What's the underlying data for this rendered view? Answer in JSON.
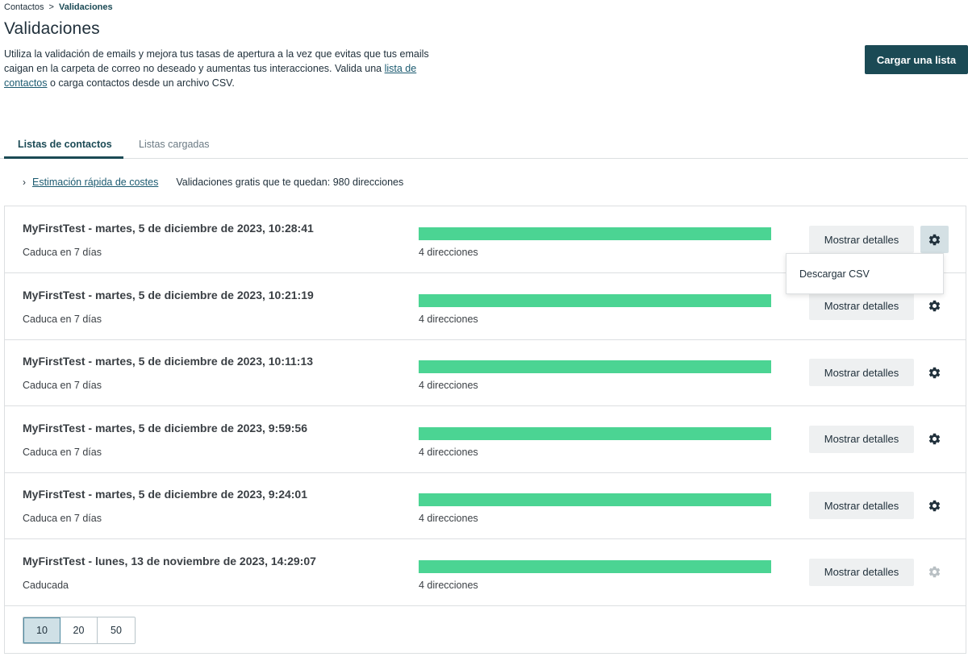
{
  "breadcrumb": {
    "parent": "Contactos",
    "separator": ">",
    "current": "Validaciones"
  },
  "page": {
    "title": "Validaciones",
    "intro_part1": "Utiliza la validación de emails y mejora tus tasas de apertura a la vez que evitas que tus emails caigan en la carpeta de correo no deseado y aumentas tus interacciones. Valida una ",
    "intro_link": "lista de contactos",
    "intro_part2": " o carga contactos desde un archivo CSV.",
    "upload_button": "Cargar una lista"
  },
  "tabs": [
    {
      "label": "Listas de contactos",
      "active": true
    },
    {
      "label": "Listas cargadas",
      "active": false
    }
  ],
  "estimate": {
    "link": "Estimación rápida de costes",
    "free_validations": "Validaciones gratis que te quedan: 980 direcciones"
  },
  "rows": [
    {
      "title": "MyFirstTest - martes, 5 de diciembre de 2023, 10:28:41",
      "status": "Caduca en 7 días",
      "addresses": "4 direcciones",
      "progress": 1.0,
      "details_label": "Mostrar detalles",
      "gear_state": "open"
    },
    {
      "title": "MyFirstTest - martes, 5 de diciembre de 2023, 10:21:19",
      "status": "Caduca en 7 días",
      "addresses": "4 direcciones",
      "progress": 1.0,
      "details_label": "Mostrar detalles",
      "gear_state": "active"
    },
    {
      "title": "MyFirstTest - martes, 5 de diciembre de 2023, 10:11:13",
      "status": "Caduca en 7 días",
      "addresses": "4 direcciones",
      "progress": 1.0,
      "details_label": "Mostrar detalles",
      "gear_state": "active"
    },
    {
      "title": "MyFirstTest - martes, 5 de diciembre de 2023, 9:59:56",
      "status": "Caduca en 7 días",
      "addresses": "4 direcciones",
      "progress": 1.0,
      "details_label": "Mostrar detalles",
      "gear_state": "active"
    },
    {
      "title": "MyFirstTest - martes, 5 de diciembre de 2023, 9:24:01",
      "status": "Caduca en 7 días",
      "addresses": "4 direcciones",
      "progress": 1.0,
      "details_label": "Mostrar detalles",
      "gear_state": "active"
    },
    {
      "title": "MyFirstTest - lunes, 13 de noviembre de 2023, 14:29:07",
      "status": "Caducada",
      "addresses": "4 direcciones",
      "progress": 1.0,
      "details_label": "Mostrar detalles",
      "gear_state": "disabled"
    }
  ],
  "dropdown": {
    "item": "Descargar CSV"
  },
  "pagination": {
    "options": [
      "10",
      "20",
      "50"
    ],
    "selected": "10"
  },
  "icons": {
    "gear": "gear-icon",
    "chevron": "chevron-right-icon"
  },
  "colors": {
    "primary": "#1b4a55",
    "progress": "#4bd493",
    "gear_active": "#21313c",
    "gear_disabled": "#b9c0c4"
  }
}
